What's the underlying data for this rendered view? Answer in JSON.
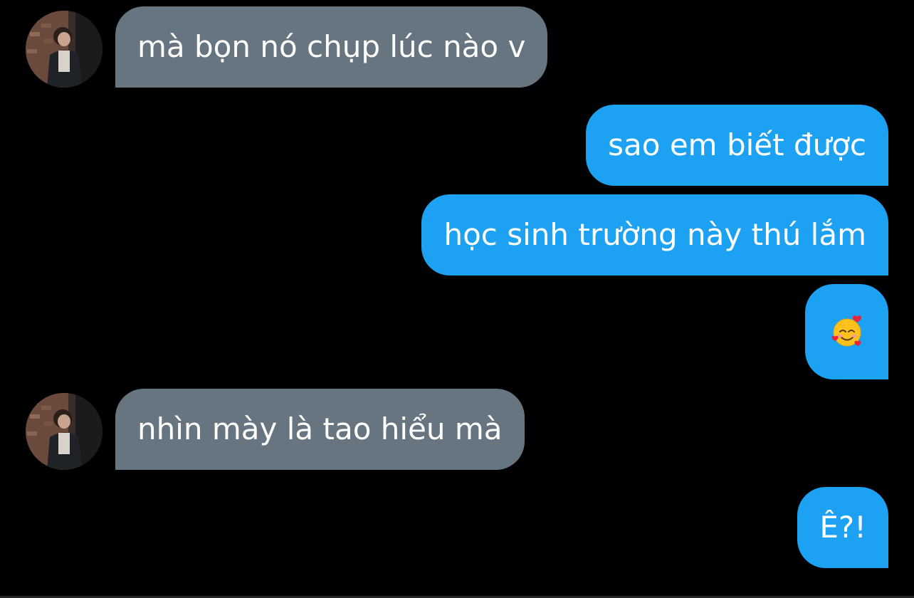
{
  "conversation": {
    "messages": [
      {
        "side": "received",
        "text": "mà bọn nó chụp lúc nào v"
      },
      {
        "side": "sent",
        "text": "sao em biết được"
      },
      {
        "side": "sent",
        "text": "học sinh trường này thú lắm"
      },
      {
        "side": "sent",
        "emoji": "smiling-face-with-hearts"
      },
      {
        "side": "received",
        "text": "nhìn mày là tao hiểu mà"
      },
      {
        "side": "sent",
        "text": "Ê?!"
      }
    ]
  },
  "colors": {
    "background": "#000000",
    "received_bubble": "#66757f",
    "sent_bubble": "#1da1f2",
    "text": "#ffffff"
  }
}
